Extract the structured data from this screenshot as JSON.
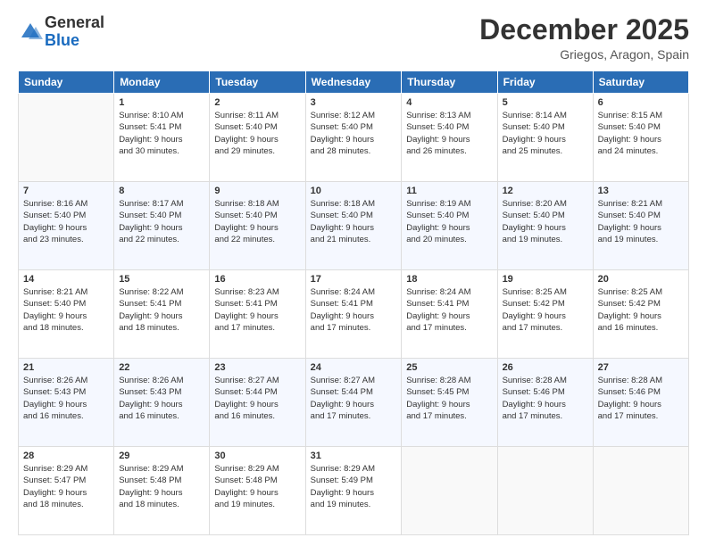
{
  "header": {
    "logo": {
      "general": "General",
      "blue": "Blue"
    },
    "title": "December 2025",
    "location": "Griegos, Aragon, Spain"
  },
  "days_of_week": [
    "Sunday",
    "Monday",
    "Tuesday",
    "Wednesday",
    "Thursday",
    "Friday",
    "Saturday"
  ],
  "weeks": [
    [
      {
        "day": "",
        "sunrise": "",
        "sunset": "",
        "daylight": ""
      },
      {
        "day": "1",
        "sunrise": "Sunrise: 8:10 AM",
        "sunset": "Sunset: 5:41 PM",
        "daylight": "Daylight: 9 hours and 30 minutes."
      },
      {
        "day": "2",
        "sunrise": "Sunrise: 8:11 AM",
        "sunset": "Sunset: 5:40 PM",
        "daylight": "Daylight: 9 hours and 29 minutes."
      },
      {
        "day": "3",
        "sunrise": "Sunrise: 8:12 AM",
        "sunset": "Sunset: 5:40 PM",
        "daylight": "Daylight: 9 hours and 28 minutes."
      },
      {
        "day": "4",
        "sunrise": "Sunrise: 8:13 AM",
        "sunset": "Sunset: 5:40 PM",
        "daylight": "Daylight: 9 hours and 26 minutes."
      },
      {
        "day": "5",
        "sunrise": "Sunrise: 8:14 AM",
        "sunset": "Sunset: 5:40 PM",
        "daylight": "Daylight: 9 hours and 25 minutes."
      },
      {
        "day": "6",
        "sunrise": "Sunrise: 8:15 AM",
        "sunset": "Sunset: 5:40 PM",
        "daylight": "Daylight: 9 hours and 24 minutes."
      }
    ],
    [
      {
        "day": "7",
        "sunrise": "Sunrise: 8:16 AM",
        "sunset": "Sunset: 5:40 PM",
        "daylight": "Daylight: 9 hours and 23 minutes."
      },
      {
        "day": "8",
        "sunrise": "Sunrise: 8:17 AM",
        "sunset": "Sunset: 5:40 PM",
        "daylight": "Daylight: 9 hours and 22 minutes."
      },
      {
        "day": "9",
        "sunrise": "Sunrise: 8:18 AM",
        "sunset": "Sunset: 5:40 PM",
        "daylight": "Daylight: 9 hours and 22 minutes."
      },
      {
        "day": "10",
        "sunrise": "Sunrise: 8:18 AM",
        "sunset": "Sunset: 5:40 PM",
        "daylight": "Daylight: 9 hours and 21 minutes."
      },
      {
        "day": "11",
        "sunrise": "Sunrise: 8:19 AM",
        "sunset": "Sunset: 5:40 PM",
        "daylight": "Daylight: 9 hours and 20 minutes."
      },
      {
        "day": "12",
        "sunrise": "Sunrise: 8:20 AM",
        "sunset": "Sunset: 5:40 PM",
        "daylight": "Daylight: 9 hours and 19 minutes."
      },
      {
        "day": "13",
        "sunrise": "Sunrise: 8:21 AM",
        "sunset": "Sunset: 5:40 PM",
        "daylight": "Daylight: 9 hours and 19 minutes."
      }
    ],
    [
      {
        "day": "14",
        "sunrise": "Sunrise: 8:21 AM",
        "sunset": "Sunset: 5:40 PM",
        "daylight": "Daylight: 9 hours and 18 minutes."
      },
      {
        "day": "15",
        "sunrise": "Sunrise: 8:22 AM",
        "sunset": "Sunset: 5:41 PM",
        "daylight": "Daylight: 9 hours and 18 minutes."
      },
      {
        "day": "16",
        "sunrise": "Sunrise: 8:23 AM",
        "sunset": "Sunset: 5:41 PM",
        "daylight": "Daylight: 9 hours and 17 minutes."
      },
      {
        "day": "17",
        "sunrise": "Sunrise: 8:24 AM",
        "sunset": "Sunset: 5:41 PM",
        "daylight": "Daylight: 9 hours and 17 minutes."
      },
      {
        "day": "18",
        "sunrise": "Sunrise: 8:24 AM",
        "sunset": "Sunset: 5:41 PM",
        "daylight": "Daylight: 9 hours and 17 minutes."
      },
      {
        "day": "19",
        "sunrise": "Sunrise: 8:25 AM",
        "sunset": "Sunset: 5:42 PM",
        "daylight": "Daylight: 9 hours and 17 minutes."
      },
      {
        "day": "20",
        "sunrise": "Sunrise: 8:25 AM",
        "sunset": "Sunset: 5:42 PM",
        "daylight": "Daylight: 9 hours and 16 minutes."
      }
    ],
    [
      {
        "day": "21",
        "sunrise": "Sunrise: 8:26 AM",
        "sunset": "Sunset: 5:43 PM",
        "daylight": "Daylight: 9 hours and 16 minutes."
      },
      {
        "day": "22",
        "sunrise": "Sunrise: 8:26 AM",
        "sunset": "Sunset: 5:43 PM",
        "daylight": "Daylight: 9 hours and 16 minutes."
      },
      {
        "day": "23",
        "sunrise": "Sunrise: 8:27 AM",
        "sunset": "Sunset: 5:44 PM",
        "daylight": "Daylight: 9 hours and 16 minutes."
      },
      {
        "day": "24",
        "sunrise": "Sunrise: 8:27 AM",
        "sunset": "Sunset: 5:44 PM",
        "daylight": "Daylight: 9 hours and 17 minutes."
      },
      {
        "day": "25",
        "sunrise": "Sunrise: 8:28 AM",
        "sunset": "Sunset: 5:45 PM",
        "daylight": "Daylight: 9 hours and 17 minutes."
      },
      {
        "day": "26",
        "sunrise": "Sunrise: 8:28 AM",
        "sunset": "Sunset: 5:46 PM",
        "daylight": "Daylight: 9 hours and 17 minutes."
      },
      {
        "day": "27",
        "sunrise": "Sunrise: 8:28 AM",
        "sunset": "Sunset: 5:46 PM",
        "daylight": "Daylight: 9 hours and 17 minutes."
      }
    ],
    [
      {
        "day": "28",
        "sunrise": "Sunrise: 8:29 AM",
        "sunset": "Sunset: 5:47 PM",
        "daylight": "Daylight: 9 hours and 18 minutes."
      },
      {
        "day": "29",
        "sunrise": "Sunrise: 8:29 AM",
        "sunset": "Sunset: 5:48 PM",
        "daylight": "Daylight: 9 hours and 18 minutes."
      },
      {
        "day": "30",
        "sunrise": "Sunrise: 8:29 AM",
        "sunset": "Sunset: 5:48 PM",
        "daylight": "Daylight: 9 hours and 19 minutes."
      },
      {
        "day": "31",
        "sunrise": "Sunrise: 8:29 AM",
        "sunset": "Sunset: 5:49 PM",
        "daylight": "Daylight: 9 hours and 19 minutes."
      },
      {
        "day": "",
        "sunrise": "",
        "sunset": "",
        "daylight": ""
      },
      {
        "day": "",
        "sunrise": "",
        "sunset": "",
        "daylight": ""
      },
      {
        "day": "",
        "sunrise": "",
        "sunset": "",
        "daylight": ""
      }
    ]
  ]
}
